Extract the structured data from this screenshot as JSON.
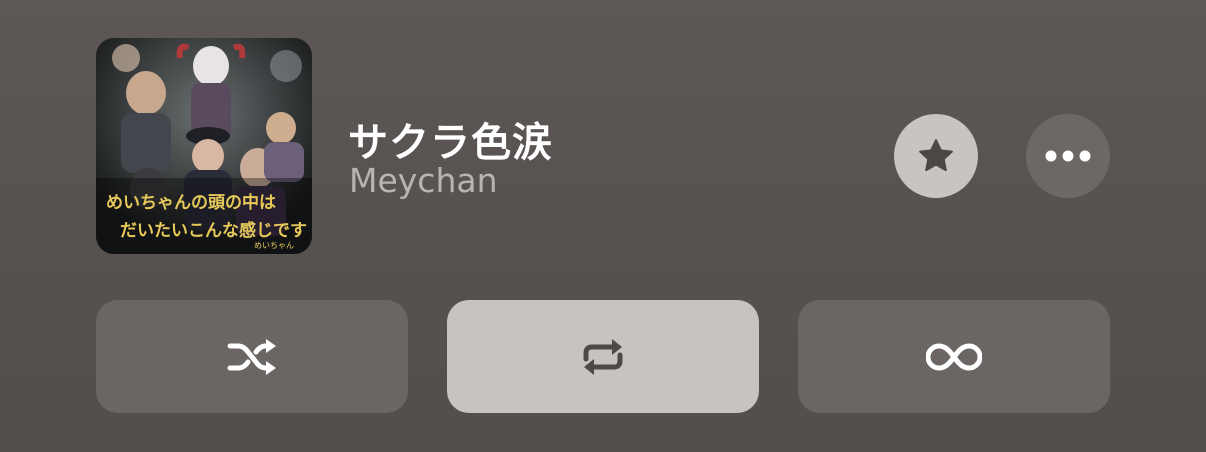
{
  "now_playing": {
    "title": "サクラ色涙",
    "artist": "Meychan",
    "artwork_alt": "Album artwork",
    "artwork_text_line1": "めいちゃんの頭の中は",
    "artwork_text_line2": "だいたいこんな感じです",
    "artwork_signature": "めいちゃん"
  },
  "actions": {
    "favorite_icon": "star-icon",
    "more_icon": "ellipsis-icon"
  },
  "controls": {
    "shuffle": {
      "icon": "shuffle-icon",
      "active": false
    },
    "repeat": {
      "icon": "repeat-icon",
      "active": true
    },
    "infinite": {
      "icon": "infinity-icon",
      "active": false
    }
  },
  "colors": {
    "background": "#585251",
    "active_control": "#c8c2c1",
    "inactive_control": "#6b6564",
    "title": "#ffffff",
    "artist": "#b9b3b2"
  }
}
